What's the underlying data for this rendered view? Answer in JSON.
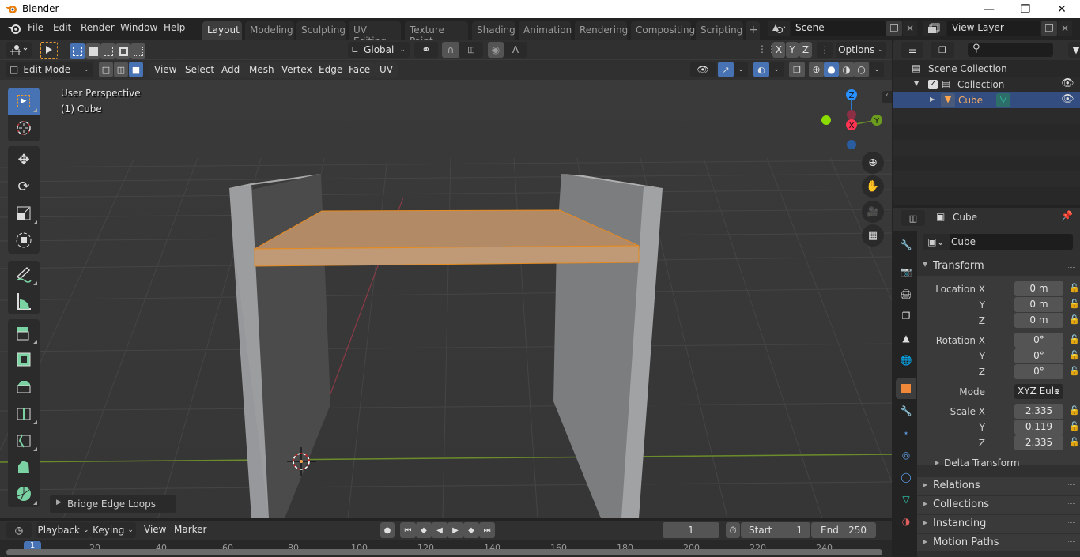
{
  "window": {
    "title": "Blender",
    "controls": [
      "minimize",
      "restore",
      "close"
    ]
  },
  "menubar": {
    "menus": [
      "File",
      "Edit",
      "Render",
      "Window",
      "Help"
    ],
    "workspaces": [
      "Layout",
      "Modeling",
      "Sculpting",
      "UV Editing",
      "Texture Paint",
      "Shading",
      "Animation",
      "Rendering",
      "Compositing",
      "Scripting"
    ],
    "active_workspace": "Layout",
    "add_workspace": "+",
    "scene": "Scene",
    "view_layer": "View Layer"
  },
  "viewport_header": {
    "transform_orientation": "Global",
    "axes": [
      "X",
      "Y",
      "Z"
    ],
    "options_label": "Options",
    "mode": "Edit Mode",
    "menus": [
      "View",
      "Select",
      "Add",
      "Mesh",
      "Vertex",
      "Edge",
      "Face",
      "UV"
    ],
    "select_mode_active": "face",
    "shading_active": "solid"
  },
  "viewport": {
    "perspective_label": "User Perspective",
    "object_label": "(1) Cube",
    "last_operator": "Bridge Edge Loops",
    "gizmo_axes": {
      "x": "X",
      "y": "Y",
      "z": "Z"
    },
    "colors": {
      "x_axis": "#ff3352",
      "y_axis": "#8bdc00",
      "z_axis": "#2890ff",
      "selection": "#ffa54d",
      "grid_green": "#6b8c2a"
    }
  },
  "toolbar": {
    "tools": [
      "select-box",
      "cursor",
      "move",
      "rotate",
      "scale",
      "transform",
      "annotate",
      "measure",
      "extrude-region",
      "inset-faces",
      "bevel",
      "loop-cut",
      "knife",
      "poly-build",
      "spin"
    ],
    "active_tool": "select-box"
  },
  "nav_gizmos": [
    "zoom",
    "pan",
    "camera",
    "ortho-toggle"
  ],
  "outliner": {
    "search_placeholder": "",
    "items": [
      {
        "label": "Scene Collection",
        "level": 0
      },
      {
        "label": "Collection",
        "level": 1,
        "checked": true,
        "visible": true
      },
      {
        "label": "Cube",
        "level": 2,
        "selected": true,
        "visible": true
      }
    ]
  },
  "properties": {
    "header_object": "Cube",
    "object_name": "Cube",
    "transform_title": "Transform",
    "location": {
      "label": "Location X",
      "x": "0 m",
      "y": "0 m",
      "z": "0 m"
    },
    "rotation": {
      "label": "Rotation X",
      "x": "0°",
      "y": "0°",
      "z": "0°"
    },
    "mode_label": "Mode",
    "mode_value": "XYZ Eule",
    "scale": {
      "label": "Scale X",
      "x": "2.335",
      "y": "0.119",
      "z": "2.335"
    },
    "axis_y": "Y",
    "axis_z": "Z",
    "subpanels": [
      "Delta Transform"
    ],
    "panels": [
      "Relations",
      "Collections",
      "Instancing",
      "Motion Paths"
    ],
    "tabs": [
      "tool",
      "render",
      "output",
      "view-layer",
      "scene",
      "world",
      "object",
      "modifier",
      "particles",
      "physics",
      "constraints",
      "data",
      "material"
    ],
    "active_tab": "object"
  },
  "timeline": {
    "menus": [
      "Playback",
      "Keying",
      "View",
      "Marker"
    ],
    "current_frame": "1",
    "start_label": "Start",
    "start": "1",
    "end_label": "End",
    "end": "250",
    "ruler_ticks": [
      "1",
      "20",
      "40",
      "60",
      "80",
      "100",
      "120",
      "140",
      "160",
      "180",
      "200",
      "220",
      "240"
    ]
  }
}
